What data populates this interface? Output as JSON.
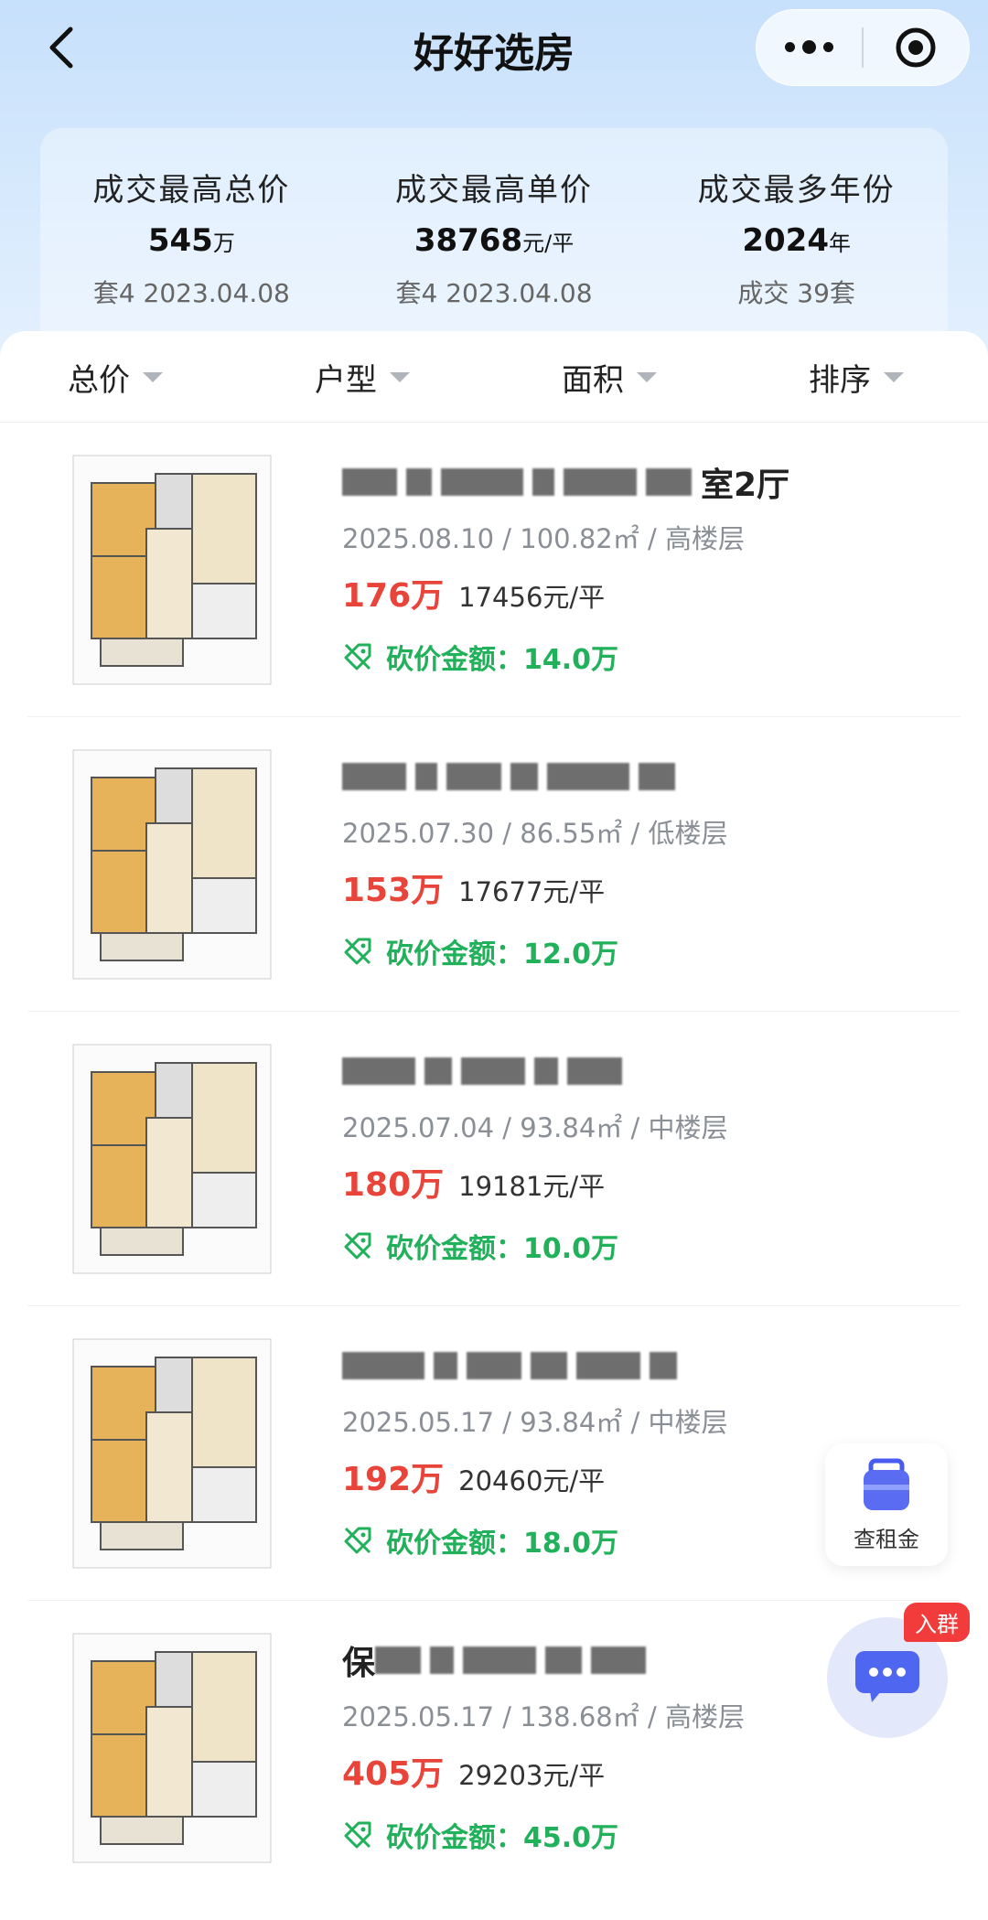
{
  "nav": {
    "title": "好好选房"
  },
  "stats": [
    {
      "label": "成交最高总价",
      "value": "545",
      "unit": "万",
      "sub": "套4 2023.04.08"
    },
    {
      "label": "成交最高单价",
      "value": "38768",
      "unit": "元/平",
      "sub": "套4 2023.04.08"
    },
    {
      "label": "成交最多年份",
      "value": "2024",
      "unit": "年",
      "sub": "成交 39套"
    }
  ],
  "filters": [
    "总价",
    "户型",
    "面积",
    "排序"
  ],
  "listings": [
    {
      "title_suffix": "室2厅",
      "date": "2025.08.10",
      "area": "100.82㎡",
      "floor": "高楼层",
      "price": "176万",
      "unit_price": "17456元/平",
      "bargain_label": "砍价金额：",
      "bargain_value": "14.0万"
    },
    {
      "title_suffix": "",
      "date": "2025.07.30",
      "area": "86.55㎡",
      "floor": "低楼层",
      "price": "153万",
      "unit_price": "17677元/平",
      "bargain_label": "砍价金额：",
      "bargain_value": "12.0万"
    },
    {
      "title_suffix": "",
      "date": "2025.07.04",
      "area": "93.84㎡",
      "floor": "中楼层",
      "price": "180万",
      "unit_price": "19181元/平",
      "bargain_label": "砍价金额：",
      "bargain_value": "10.0万"
    },
    {
      "title_suffix": "",
      "date": "2025.05.17",
      "area": "93.84㎡",
      "floor": "中楼层",
      "price": "192万",
      "unit_price": "20460元/平",
      "bargain_label": "砍价金额：",
      "bargain_value": "18.0万"
    },
    {
      "title_prefix": "保",
      "title_suffix": "",
      "date": "2025.05.17",
      "area": "138.68㎡",
      "floor": "高楼层",
      "price": "405万",
      "unit_price": "29203元/平",
      "bargain_label": "砍价金额：",
      "bargain_value": "45.0万"
    }
  ],
  "float_rent": {
    "label": "查租金"
  },
  "float_group": {
    "badge": "入群"
  },
  "colors": {
    "accent_red": "#e8443a",
    "bargain_green": "#20b15a"
  }
}
